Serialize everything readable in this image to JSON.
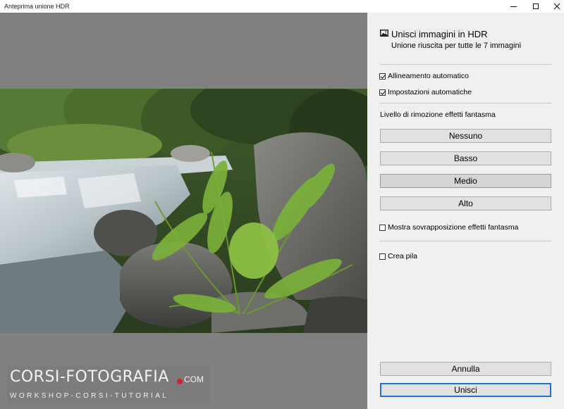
{
  "window": {
    "title": "Anteprima unione HDR"
  },
  "watermark": {
    "brand": "CORSI-FOTOGRAFIA",
    "domain": "COM",
    "tagline": "WORKSHOP-CORSI-TUTORIAL"
  },
  "panel": {
    "title": "Unisci immagini in HDR",
    "subtitle": "Unione riuscita per tutte le 7 immagini",
    "title_icon": "image-icon",
    "auto_align": {
      "label": "Allineamento automatico",
      "checked": true
    },
    "auto_settings": {
      "label": "Impostazioni automatiche",
      "checked": true
    },
    "deghost_label": "Livello di rimozione effetti fantasma",
    "deghost_levels": [
      "Nessuno",
      "Basso",
      "Medio",
      "Alto"
    ],
    "deghost_selected": "Medio",
    "show_overlay": {
      "label": "Mostra sovrapposizione effetti fantasma",
      "checked": false
    },
    "create_stack": {
      "label": "Crea pila",
      "checked": false
    },
    "cancel_label": "Annulla",
    "merge_label": "Unisci"
  },
  "colors": {
    "preview_bg": "#808080",
    "panel_bg": "#f0f0f0",
    "primary_border": "#1f73c8",
    "watermark_dot": "#d6202a"
  }
}
